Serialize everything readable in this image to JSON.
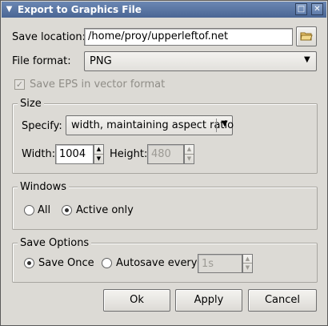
{
  "window": {
    "title": "Export to Graphics File"
  },
  "save_location": {
    "label": "Save location:",
    "value": "/home/proy/upperleftof.net"
  },
  "file_format": {
    "label": "File format:",
    "value": "PNG"
  },
  "save_eps": {
    "label": "Save EPS in vector format",
    "checked": true,
    "enabled": false
  },
  "size": {
    "group_label": "Size",
    "specify_label": "Specify:",
    "specify_value": "width, maintaining aspect ratio",
    "width_label": "Width:",
    "width_value": "1004",
    "height_label": "Height:",
    "height_value": "480"
  },
  "windows": {
    "group_label": "Windows",
    "all_label": "All",
    "active_label": "Active only",
    "selected": "active"
  },
  "save_options": {
    "group_label": "Save Options",
    "once_label": "Save Once",
    "autosave_label": "Autosave every",
    "interval_value": "1s",
    "selected": "once"
  },
  "buttons": {
    "ok": "Ok",
    "apply": "Apply",
    "cancel": "Cancel"
  }
}
